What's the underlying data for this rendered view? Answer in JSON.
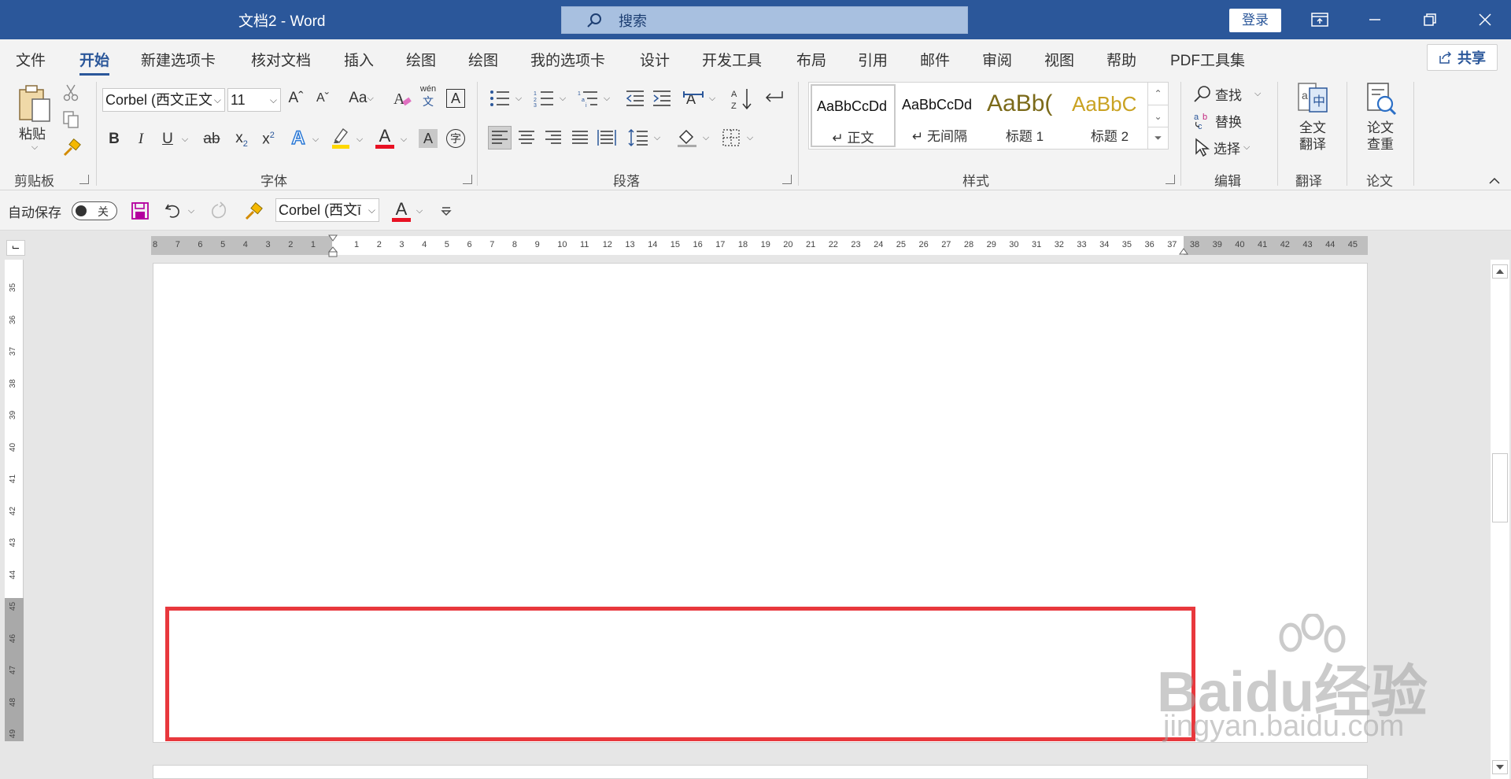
{
  "window": {
    "title": "文档2  -  Word",
    "search_placeholder": "搜索",
    "login_label": "登录"
  },
  "menu": {
    "tabs": [
      "文件",
      "开始",
      "新建选项卡",
      "核对文档",
      "插入",
      "绘图",
      "绘图",
      "我的选项卡",
      "设计",
      "开发工具",
      "布局",
      "引用",
      "邮件",
      "审阅",
      "视图",
      "帮助",
      "PDF工具集"
    ],
    "active_tab": "开始",
    "share_label": "共享"
  },
  "ribbon": {
    "clipboard": {
      "paste_label": "粘贴",
      "group_label": "剪贴板"
    },
    "font": {
      "font_name": "Corbel (西文正文",
      "font_size": "11",
      "aa_label": "Aa",
      "wen_label": "wén",
      "group_label": "字体"
    },
    "paragraph": {
      "group_label": "段落"
    },
    "styles": {
      "items": [
        {
          "sample": "AaBbCcDd",
          "name": "↵ 正文"
        },
        {
          "sample": "AaBbCcDd",
          "name": "↵ 无间隔"
        },
        {
          "sample": "AaBb(",
          "name": "标题 1"
        },
        {
          "sample": "AaBbC",
          "name": "标题 2"
        }
      ],
      "group_label": "样式"
    },
    "editing": {
      "find": "查找",
      "replace": "替换",
      "select": "选择",
      "group_label": "编辑"
    },
    "translate": {
      "button": "全文\n翻译",
      "group_label": "翻译"
    },
    "paper": {
      "button": "论文\n查重",
      "group_label": "论文"
    }
  },
  "qat": {
    "autosave_label": "自动保存",
    "toggle_state": "关",
    "font_name": "Corbel (西文ī"
  },
  "rulers": {
    "horizontal_left": [
      "8",
      "7",
      "6",
      "5",
      "4",
      "3",
      "2",
      "1"
    ],
    "horizontal_right": [
      "1",
      "2",
      "3",
      "4",
      "5",
      "6",
      "7",
      "8",
      "9",
      "10",
      "11",
      "12",
      "13",
      "14",
      "15",
      "16",
      "17",
      "18",
      "19",
      "20",
      "21",
      "22",
      "23",
      "24",
      "25",
      "26",
      "27",
      "28",
      "29",
      "30",
      "31",
      "32",
      "33",
      "34",
      "35",
      "36",
      "37",
      "38",
      "39",
      "40",
      "41",
      "42",
      "43",
      "44",
      "45"
    ],
    "vertical": [
      "35",
      "36",
      "37",
      "38",
      "39",
      "40",
      "41",
      "42",
      "43",
      "44",
      "45",
      "46",
      "47",
      "48",
      "49"
    ]
  },
  "watermark": {
    "brand": "Baidu经验",
    "url": "jingyan.baidu.com"
  },
  "colors": {
    "brand": "#2b579a",
    "highlight_box": "#e8383d",
    "font_color_bar": "#e81123",
    "highlight_bar": "#ffd800"
  }
}
